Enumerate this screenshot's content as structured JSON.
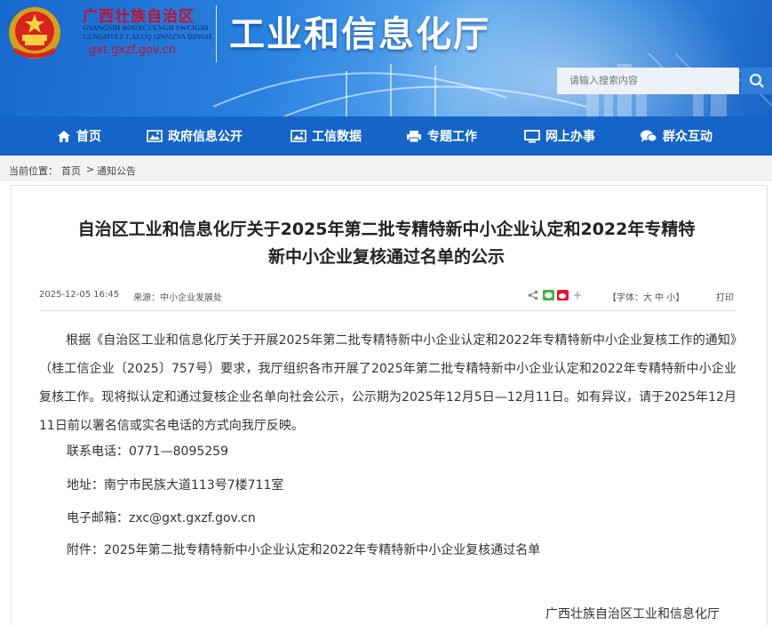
{
  "header": {
    "region_name": "广西壮族自治区",
    "zhuang_line1": "GVANGSIH BOUXCUENGH SWCIGIH",
    "zhuang_line2": "GUNGHYEZ CAEUQ SINSIZVA DINGH",
    "url": "gxt.gxzf.gov.cn",
    "site_title": "工业和信息化厅",
    "search_placeholder": "请输入搜索内容",
    "colors": {
      "brand_red": "#c8102e",
      "nav_blue": "#1565c8",
      "header_blue": "#2a82e0"
    }
  },
  "nav": {
    "items": [
      {
        "label": "首页",
        "icon": "home-icon"
      },
      {
        "label": "政府信息公开",
        "icon": "image-icon"
      },
      {
        "label": "工信数据",
        "icon": "picture-icon"
      },
      {
        "label": "专题工作",
        "icon": "printer-icon"
      },
      {
        "label": "网上办事",
        "icon": "monitor-icon"
      },
      {
        "label": "群众互动",
        "icon": "chat-icon"
      }
    ]
  },
  "breadcrumb": {
    "prefix": "当前位置：",
    "items": [
      "首页",
      "通知公告"
    ],
    "separator": ">"
  },
  "article": {
    "title_line1": "自治区工业和信息化厅关于2025年第二批专精特新中小企业认定和2022年专精特",
    "title_line2": "新中小企业复核通过名单的公示",
    "date": "2025-12-05 16:45",
    "source": "来源：中小企业发展处",
    "font_size_label": "【字体：大 中 小】",
    "print_label": "打印",
    "body": "根据《自治区工业和信息化厅关于开展2025年第二批专精特新中小企业认定和2022年专精特新中小企业复核工作的通知》（桂工信企业〔2025〕757号）要求，我厅组织各市开展了2025年第二批专精特新中小企业认定和2022年专精特新中小企业复核工作。现将拟认定和通过复核企业名单向社会公示，公示期为2025年12月5日—12月11日。如有异议，请于2025年12月11日前以署名信或实名电话的方式向我厅反映。",
    "phone": "联系电话：0771—8095259",
    "address": "地址：南宁市民族大道113号7楼711室",
    "email": "电子邮箱：zxc@gxt.gxzf.gov.cn",
    "attachment_prefix": "附件：",
    "attachment_link": "2025年第二批专精特新中小企业认定和2022年专精特新中小企业复核通过名单",
    "signature": "广西壮族自治区工业和信息化厅"
  }
}
